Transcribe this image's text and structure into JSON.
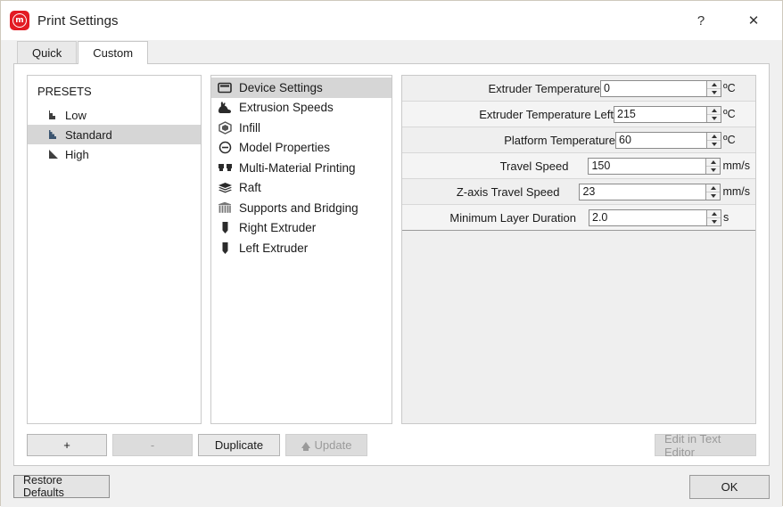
{
  "window": {
    "title": "Print Settings",
    "logo_glyph": "m",
    "help_label": "?",
    "close_label": "✕"
  },
  "tabs": [
    {
      "label": "Quick",
      "active": false
    },
    {
      "label": "Custom",
      "active": true
    }
  ],
  "presets": {
    "title": "PRESETS",
    "items": [
      {
        "label": "Low",
        "icon": "quality-low-icon",
        "selected": false
      },
      {
        "label": "Standard",
        "icon": "quality-standard-icon",
        "selected": true
      },
      {
        "label": "High",
        "icon": "quality-high-icon",
        "selected": false
      }
    ],
    "actions": {
      "add_label": "+",
      "remove_label": "-",
      "duplicate_label": "Duplicate",
      "update_label": "Update",
      "edit_in_text_editor_label": "Edit in Text Editor"
    }
  },
  "categories": [
    {
      "label": "Device Settings",
      "icon": "monitor-icon",
      "selected": true
    },
    {
      "label": "Extrusion Speeds",
      "icon": "rabbit-icon",
      "selected": false
    },
    {
      "label": "Infill",
      "icon": "cube-icon",
      "selected": false
    },
    {
      "label": "Model Properties",
      "icon": "circle-bar-icon",
      "selected": false
    },
    {
      "label": "Multi-Material Printing",
      "icon": "dual-extruder-icon",
      "selected": false
    },
    {
      "label": "Raft",
      "icon": "layers-icon",
      "selected": false
    },
    {
      "label": "Supports and Bridging",
      "icon": "supports-icon",
      "selected": false
    },
    {
      "label": "Right Extruder",
      "icon": "nozzle-icon",
      "selected": false
    },
    {
      "label": "Left Extruder",
      "icon": "nozzle-icon",
      "selected": false
    }
  ],
  "settings": [
    {
      "label": "Extruder Temperature",
      "value": "0",
      "unit": "ºC",
      "input_width": 118
    },
    {
      "label": "Extruder Temperature Left",
      "value": "215",
      "unit": "ºC",
      "input_width": 103
    },
    {
      "label": "Platform Temperature",
      "value": "60",
      "unit": "ºC",
      "input_width": 101
    },
    {
      "label": "Travel Speed",
      "value": "150",
      "unit": "mm/s",
      "input_width": 131
    },
    {
      "label": "Z-axis Travel Speed",
      "value": "23",
      "unit": "mm/s",
      "input_width": 141
    },
    {
      "label": "Minimum Layer Duration",
      "value": "2.0",
      "unit": "s",
      "input_width": 131
    }
  ],
  "footer": {
    "restore_defaults_label": "Restore Defaults",
    "ok_label": "OK"
  },
  "colors": {
    "brand_red": "#e31b23",
    "selection_gray": "#d6d6d6",
    "dialog_bg": "#f0f0f0",
    "panel_bg": "#efefef"
  }
}
